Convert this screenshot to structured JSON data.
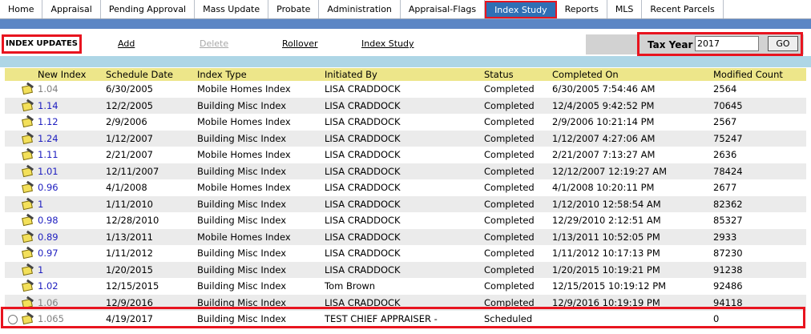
{
  "tabs": [
    "Home",
    "Appraisal",
    "Pending Approval",
    "Mass Update",
    "Probate",
    "Administration",
    "Appraisal-Flags",
    "Index Study",
    "Reports",
    "MLS",
    "Recent Parcels"
  ],
  "active_tab": "Index Study",
  "toolbar": {
    "title": "INDEX UPDATES",
    "add": "Add",
    "delete": "Delete",
    "rollover": "Rollover",
    "index_study": "Index Study",
    "tax_year_label": "Tax Year",
    "tax_year_value": "2017",
    "go": "GO"
  },
  "table": {
    "headers": [
      "New Index",
      "Schedule Date",
      "Index Type",
      "Initiated By",
      "Status",
      "Completed On",
      "Modified Count"
    ],
    "rows": [
      [
        "1.04",
        "6/30/2005",
        "Mobile Homes Index",
        "LISA CRADDOCK",
        "Completed",
        "6/30/2005 7:54:46 AM",
        "2564"
      ],
      [
        "1.14",
        "12/2/2005",
        "Building Misc Index",
        "LISA CRADDOCK",
        "Completed",
        "12/4/2005 9:42:52 PM",
        "70645"
      ],
      [
        "1.12",
        "2/9/2006",
        "Mobile Homes Index",
        "LISA CRADDOCK",
        "Completed",
        "2/9/2006 10:21:14 PM",
        "2567"
      ],
      [
        "1.24",
        "1/12/2007",
        "Building Misc Index",
        "LISA CRADDOCK",
        "Completed",
        "1/12/2007 4:27:06 AM",
        "75247"
      ],
      [
        "1.11",
        "2/21/2007",
        "Mobile Homes Index",
        "LISA CRADDOCK",
        "Completed",
        "2/21/2007 7:13:27 AM",
        "2636"
      ],
      [
        "1.01",
        "12/11/2007",
        "Building Misc Index",
        "LISA CRADDOCK",
        "Completed",
        "12/12/2007 12:19:27 AM",
        "78424"
      ],
      [
        "0.96",
        "4/1/2008",
        "Mobile Homes Index",
        "LISA CRADDOCK",
        "Completed",
        "4/1/2008 10:20:11 PM",
        "2677"
      ],
      [
        "1",
        "1/11/2010",
        "Building Misc Index",
        "LISA CRADDOCK",
        "Completed",
        "1/12/2010 12:58:54 AM",
        "82362"
      ],
      [
        "0.98",
        "12/28/2010",
        "Building Misc Index",
        "LISA CRADDOCK",
        "Completed",
        "12/29/2010 2:12:51 AM",
        "85327"
      ],
      [
        "0.89",
        "1/13/2011",
        "Mobile Homes Index",
        "LISA CRADDOCK",
        "Completed",
        "1/13/2011 10:52:05 PM",
        "2933"
      ],
      [
        "0.97",
        "1/11/2012",
        "Building Misc Index",
        "LISA CRADDOCK",
        "Completed",
        "1/11/2012 10:17:13 PM",
        "87230"
      ],
      [
        "1",
        "1/20/2015",
        "Building Misc Index",
        "LISA CRADDOCK",
        "Completed",
        "1/20/2015 10:19:21 PM",
        "91238"
      ],
      [
        "1.02",
        "12/15/2015",
        "Building Misc Index",
        "Tom Brown",
        "Completed",
        "12/15/2015 10:19:12 PM",
        "92486"
      ],
      [
        "1.06",
        "12/9/2016",
        "Building Misc Index",
        "LISA CRADDOCK",
        "Completed",
        "12/9/2016 10:19:19 PM",
        "94118"
      ],
      [
        "1.065",
        "4/19/2017",
        "Building Misc Index",
        "TEST CHIEF APPRAISER -",
        "Scheduled",
        "",
        "0"
      ]
    ]
  },
  "colors": {
    "tab_active_bg": "#2f6fb5",
    "header_bg": "#ede68a",
    "highlight": "#e8141f",
    "link": "#2020c0"
  }
}
